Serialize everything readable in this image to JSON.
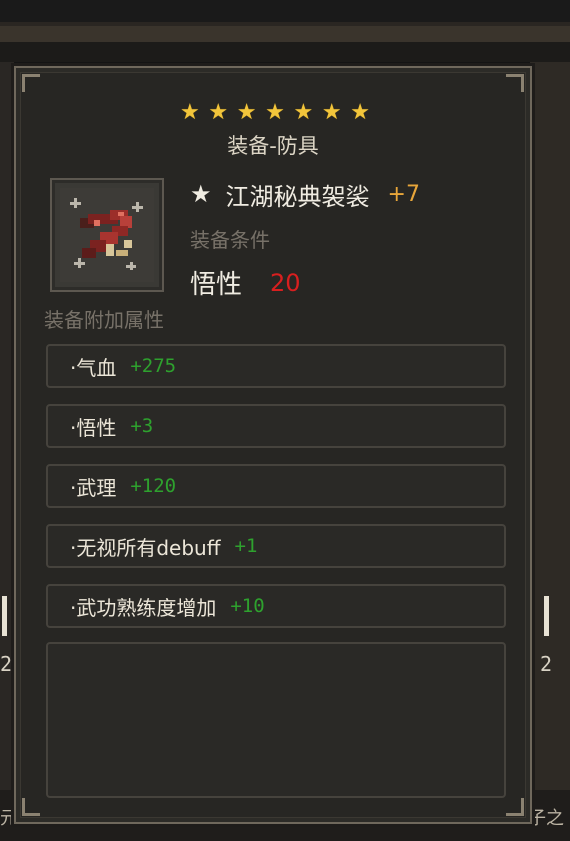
{
  "tooltip": {
    "stars": [
      "★",
      "★",
      "★",
      "★",
      "★",
      "★",
      "★"
    ],
    "category": "装备-防具",
    "item": {
      "star_glyph": "★",
      "name": "江湖秘典袈裟",
      "enhance": "+7",
      "icon": "red-scarf-armor-icon"
    },
    "requirement": {
      "label": "装备条件",
      "stat": "悟性",
      "value": "20"
    },
    "bonus_label": "装备附加属性",
    "attributes": [
      {
        "name": "·气血",
        "value": "+275"
      },
      {
        "name": "·悟性",
        "value": "+3"
      },
      {
        "name": "·武理",
        "value": "+120"
      },
      {
        "name": "·无视所有debuff",
        "value": "+1"
      },
      {
        "name": "·武功熟练度增加",
        "value": "+10"
      }
    ]
  },
  "background": {
    "left_num": "2",
    "right_num": "2",
    "bottom_left_text": "元",
    "bottom_right_text": "子之"
  },
  "colors": {
    "star": "#f2c53b",
    "enhance": "#e8a63a",
    "requirement_value": "#d81f1f",
    "bonus_value": "#2ea12e"
  }
}
